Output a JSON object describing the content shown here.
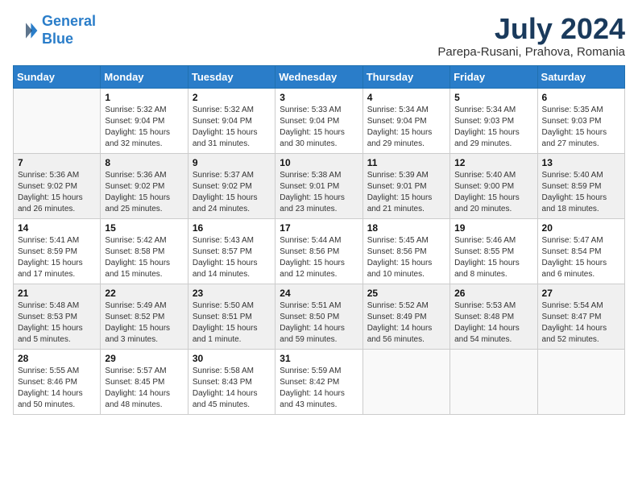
{
  "logo": {
    "line1": "General",
    "line2": "Blue"
  },
  "title": "July 2024",
  "location": "Parepa-Rusani, Prahova, Romania",
  "days_of_week": [
    "Sunday",
    "Monday",
    "Tuesday",
    "Wednesday",
    "Thursday",
    "Friday",
    "Saturday"
  ],
  "weeks": [
    [
      {
        "day": "",
        "info": ""
      },
      {
        "day": "1",
        "info": "Sunrise: 5:32 AM\nSunset: 9:04 PM\nDaylight: 15 hours\nand 32 minutes."
      },
      {
        "day": "2",
        "info": "Sunrise: 5:32 AM\nSunset: 9:04 PM\nDaylight: 15 hours\nand 31 minutes."
      },
      {
        "day": "3",
        "info": "Sunrise: 5:33 AM\nSunset: 9:04 PM\nDaylight: 15 hours\nand 30 minutes."
      },
      {
        "day": "4",
        "info": "Sunrise: 5:34 AM\nSunset: 9:04 PM\nDaylight: 15 hours\nand 29 minutes."
      },
      {
        "day": "5",
        "info": "Sunrise: 5:34 AM\nSunset: 9:03 PM\nDaylight: 15 hours\nand 29 minutes."
      },
      {
        "day": "6",
        "info": "Sunrise: 5:35 AM\nSunset: 9:03 PM\nDaylight: 15 hours\nand 27 minutes."
      }
    ],
    [
      {
        "day": "7",
        "info": "Sunrise: 5:36 AM\nSunset: 9:02 PM\nDaylight: 15 hours\nand 26 minutes."
      },
      {
        "day": "8",
        "info": "Sunrise: 5:36 AM\nSunset: 9:02 PM\nDaylight: 15 hours\nand 25 minutes."
      },
      {
        "day": "9",
        "info": "Sunrise: 5:37 AM\nSunset: 9:02 PM\nDaylight: 15 hours\nand 24 minutes."
      },
      {
        "day": "10",
        "info": "Sunrise: 5:38 AM\nSunset: 9:01 PM\nDaylight: 15 hours\nand 23 minutes."
      },
      {
        "day": "11",
        "info": "Sunrise: 5:39 AM\nSunset: 9:01 PM\nDaylight: 15 hours\nand 21 minutes."
      },
      {
        "day": "12",
        "info": "Sunrise: 5:40 AM\nSunset: 9:00 PM\nDaylight: 15 hours\nand 20 minutes."
      },
      {
        "day": "13",
        "info": "Sunrise: 5:40 AM\nSunset: 8:59 PM\nDaylight: 15 hours\nand 18 minutes."
      }
    ],
    [
      {
        "day": "14",
        "info": "Sunrise: 5:41 AM\nSunset: 8:59 PM\nDaylight: 15 hours\nand 17 minutes."
      },
      {
        "day": "15",
        "info": "Sunrise: 5:42 AM\nSunset: 8:58 PM\nDaylight: 15 hours\nand 15 minutes."
      },
      {
        "day": "16",
        "info": "Sunrise: 5:43 AM\nSunset: 8:57 PM\nDaylight: 15 hours\nand 14 minutes."
      },
      {
        "day": "17",
        "info": "Sunrise: 5:44 AM\nSunset: 8:56 PM\nDaylight: 15 hours\nand 12 minutes."
      },
      {
        "day": "18",
        "info": "Sunrise: 5:45 AM\nSunset: 8:56 PM\nDaylight: 15 hours\nand 10 minutes."
      },
      {
        "day": "19",
        "info": "Sunrise: 5:46 AM\nSunset: 8:55 PM\nDaylight: 15 hours\nand 8 minutes."
      },
      {
        "day": "20",
        "info": "Sunrise: 5:47 AM\nSunset: 8:54 PM\nDaylight: 15 hours\nand 6 minutes."
      }
    ],
    [
      {
        "day": "21",
        "info": "Sunrise: 5:48 AM\nSunset: 8:53 PM\nDaylight: 15 hours\nand 5 minutes."
      },
      {
        "day": "22",
        "info": "Sunrise: 5:49 AM\nSunset: 8:52 PM\nDaylight: 15 hours\nand 3 minutes."
      },
      {
        "day": "23",
        "info": "Sunrise: 5:50 AM\nSunset: 8:51 PM\nDaylight: 15 hours\nand 1 minute."
      },
      {
        "day": "24",
        "info": "Sunrise: 5:51 AM\nSunset: 8:50 PM\nDaylight: 14 hours\nand 59 minutes."
      },
      {
        "day": "25",
        "info": "Sunrise: 5:52 AM\nSunset: 8:49 PM\nDaylight: 14 hours\nand 56 minutes."
      },
      {
        "day": "26",
        "info": "Sunrise: 5:53 AM\nSunset: 8:48 PM\nDaylight: 14 hours\nand 54 minutes."
      },
      {
        "day": "27",
        "info": "Sunrise: 5:54 AM\nSunset: 8:47 PM\nDaylight: 14 hours\nand 52 minutes."
      }
    ],
    [
      {
        "day": "28",
        "info": "Sunrise: 5:55 AM\nSunset: 8:46 PM\nDaylight: 14 hours\nand 50 minutes."
      },
      {
        "day": "29",
        "info": "Sunrise: 5:57 AM\nSunset: 8:45 PM\nDaylight: 14 hours\nand 48 minutes."
      },
      {
        "day": "30",
        "info": "Sunrise: 5:58 AM\nSunset: 8:43 PM\nDaylight: 14 hours\nand 45 minutes."
      },
      {
        "day": "31",
        "info": "Sunrise: 5:59 AM\nSunset: 8:42 PM\nDaylight: 14 hours\nand 43 minutes."
      },
      {
        "day": "",
        "info": ""
      },
      {
        "day": "",
        "info": ""
      },
      {
        "day": "",
        "info": ""
      }
    ]
  ]
}
